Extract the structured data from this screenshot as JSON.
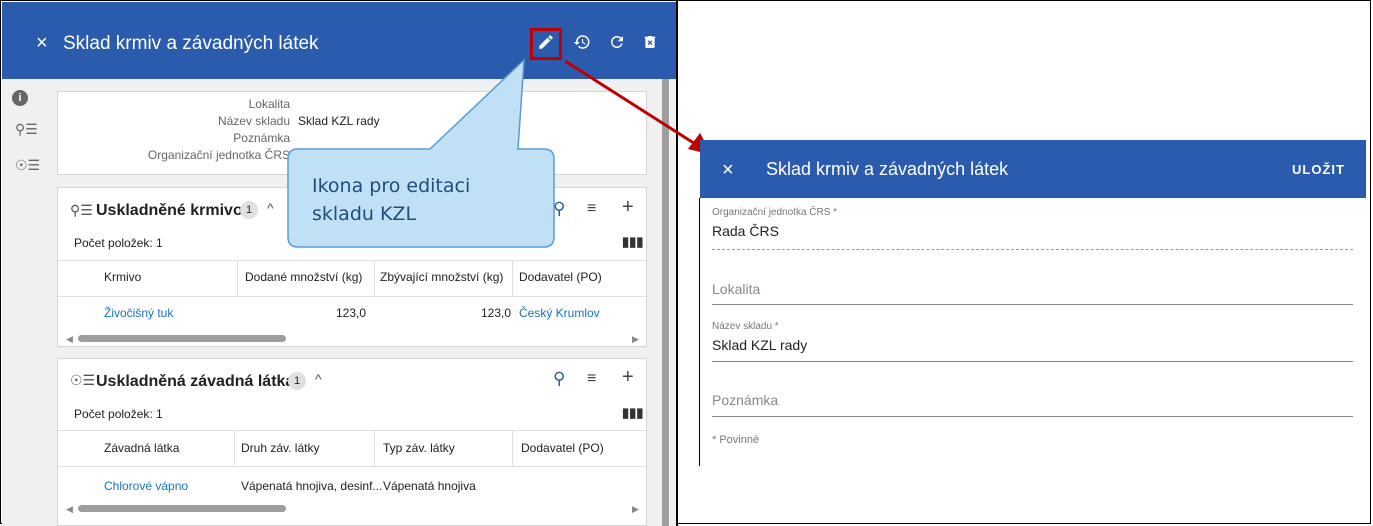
{
  "left_panel": {
    "title": "Sklad krmiv a závadných látek",
    "close_icon": "×",
    "header_icons": [
      "edit-icon",
      "history-icon",
      "refresh-icon",
      "delete-icon"
    ],
    "info": {
      "labels": [
        "Lokalita",
        "Název skladu",
        "Poznámka",
        "Organizační jednotka ČRS"
      ],
      "values": [
        "",
        "Sklad KZL rady",
        "",
        ""
      ]
    },
    "feed_section": {
      "title": "Uskladněné krmivo",
      "badge": "1",
      "count_label": "Počet položek: 1",
      "columns": [
        "Krmivo",
        "Dodané množství (kg)",
        "Zbývající množství (kg)",
        "Dodavatel (PO)"
      ],
      "rows": [
        [
          "Živočišný tuk",
          "123,0",
          "123,0",
          "Český Krumlov"
        ]
      ]
    },
    "substance_section": {
      "title": "Uskladněná závadná látka",
      "badge": "1",
      "count_label": "Počet položek: 1",
      "columns": [
        "Závadná látka",
        "Druh záv. látky",
        "Typ záv. látky",
        "Dodavatel (PO)"
      ],
      "rows": [
        [
          "Chlorové vápno",
          "Vápenatá hnojiva, desinf...",
          "Vápenatá hnojiva",
          ""
        ]
      ]
    }
  },
  "callout": {
    "line1": "Ikona pro editaci",
    "line2": "skladu KZL"
  },
  "right_panel": {
    "title": "Sklad krmiv a závadných látek",
    "close_icon": "×",
    "save_label": "ULOŽIT",
    "fields": {
      "org_label": "Organizační jednotka ČRS *",
      "org_value": "Rada ČRS",
      "locality_placeholder": "Lokalita",
      "name_label": "Název skladu *",
      "name_value": "Sklad KZL rady",
      "note_placeholder": "Poznámka"
    },
    "required_note": "* Povinné"
  },
  "colors": {
    "header_blue": "#2b5bad",
    "highlight_red": "#c00000",
    "callout_fill": "#bfe0f5",
    "callout_border": "#5b9bd5",
    "link_blue": "#1a73c8"
  }
}
